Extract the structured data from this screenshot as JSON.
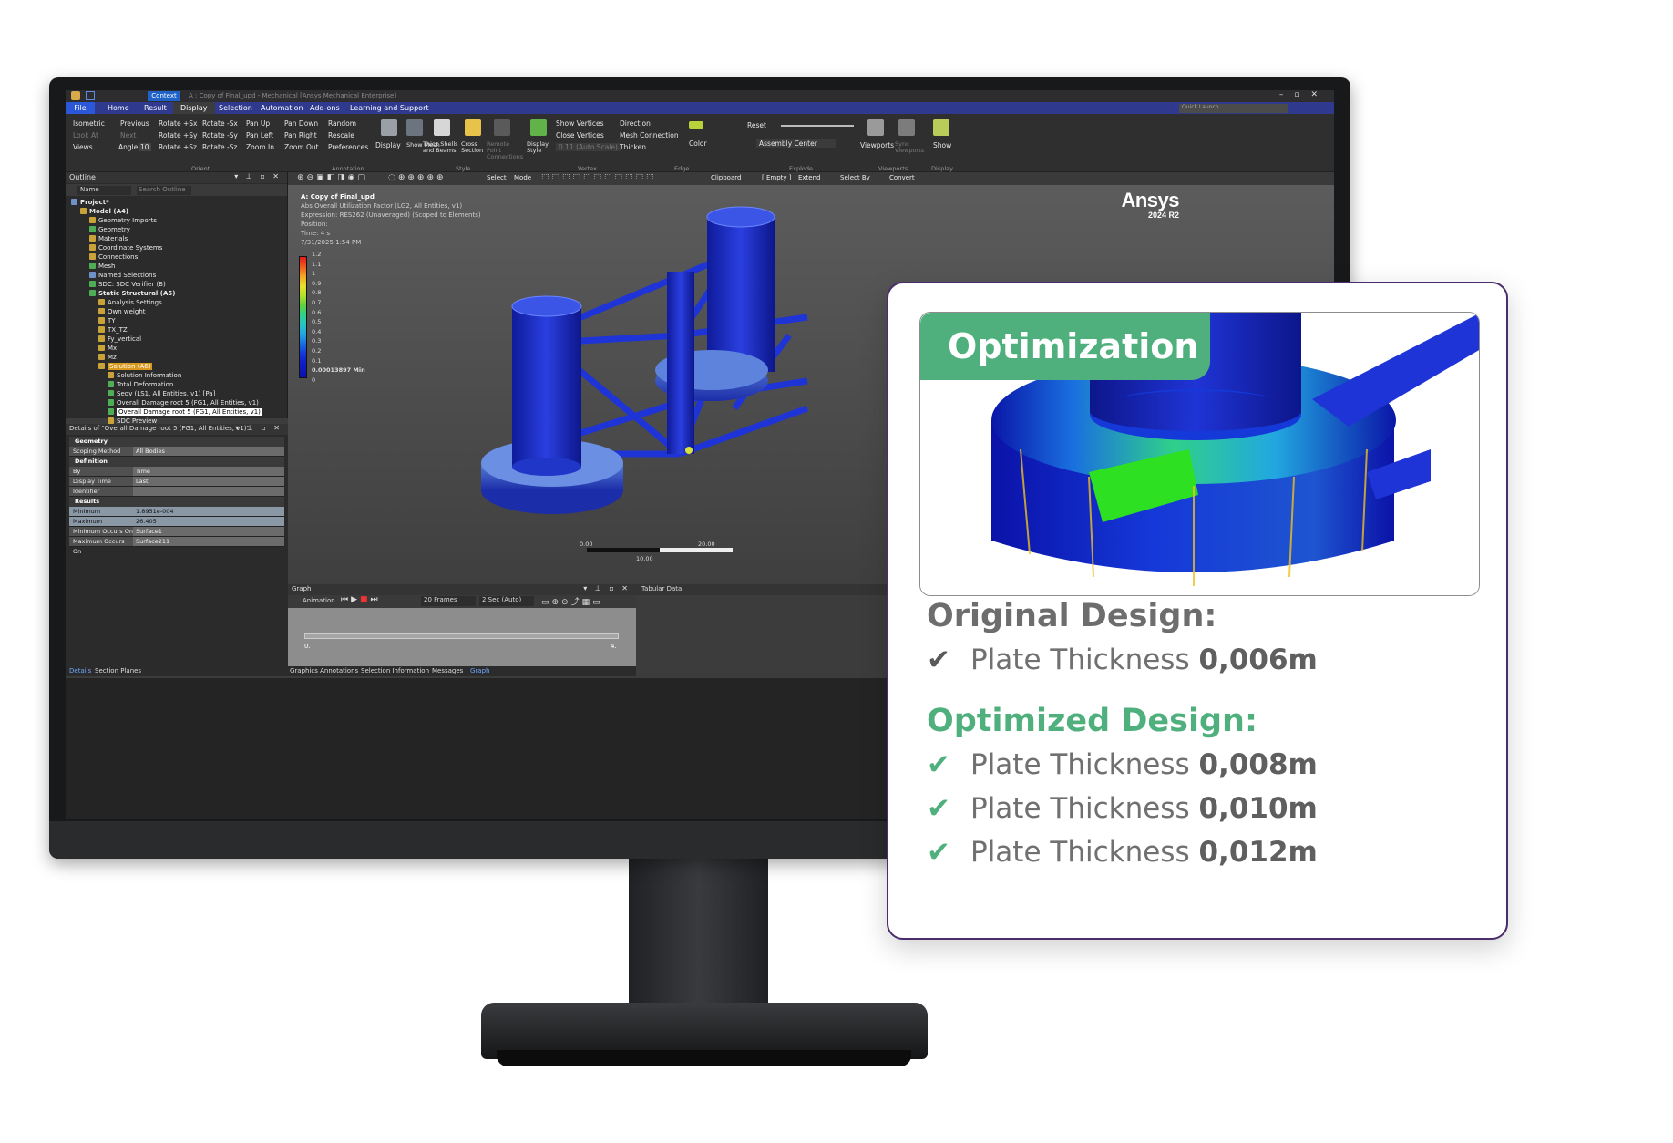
{
  "app": {
    "context_tab": "Context",
    "title": "A : Copy of Final_upd - Mechanical [Ansys Mechanical Enterprise]",
    "quick_launch": "Quick Launch",
    "tabs": [
      "File",
      "Home",
      "Result",
      "Display",
      "Selection",
      "Automation",
      "Add-ons",
      "Learning and Support"
    ]
  },
  "ribbon": {
    "orient": [
      "Isometric",
      "Previous",
      "Rotate +Sx",
      "Rotate -Sx",
      "Pan Up",
      "Pan Down",
      "Look At",
      "Next",
      "Rotate +Sy",
      "Rotate -Sy",
      "Pan Left",
      "Pan Right",
      "Views",
      "Angle",
      "10",
      "Rotate +Sz",
      "Rotate -Sz",
      "Zoom In",
      "Zoom Out"
    ],
    "annotation": [
      "Random",
      "Rescale",
      "Preferences"
    ],
    "style": [
      "Display",
      "Show Mesh",
      "Thick Shells and Beams",
      "Cross Section",
      "Remote Point Connections",
      "Display Style"
    ],
    "vertex": [
      "Show Vertices",
      "Close Vertices",
      "0.11 (Auto Scale)"
    ],
    "edge": [
      "Direction",
      "Mesh Connection",
      "Thicken",
      "Color"
    ],
    "explode": [
      "Reset",
      "Assembly Center"
    ],
    "viewports": [
      "Viewports",
      "Sync Viewports"
    ],
    "display": [
      "Show"
    ],
    "groups": [
      "Orient",
      "Annotation",
      "Style",
      "Vertex",
      "Edge",
      "Explode",
      "Viewports",
      "Display"
    ]
  },
  "outline": {
    "title": "Outline",
    "name_label": "Name",
    "search_placeholder": "Search Outline",
    "tree": [
      {
        "label": "Project*",
        "level": 0,
        "icon": "b",
        "style": "bold"
      },
      {
        "label": "Model (A4)",
        "level": 1,
        "icon": "y",
        "style": "bold"
      },
      {
        "label": "Geometry Imports",
        "level": 2,
        "icon": "y"
      },
      {
        "label": "Geometry",
        "level": 2,
        "icon": "g"
      },
      {
        "label": "Materials",
        "level": 2,
        "icon": "y"
      },
      {
        "label": "Coordinate Systems",
        "level": 2,
        "icon": "y"
      },
      {
        "label": "Connections",
        "level": 2,
        "icon": "y"
      },
      {
        "label": "Mesh",
        "level": 2,
        "icon": "g"
      },
      {
        "label": "Named Selections",
        "level": 2,
        "icon": "b"
      },
      {
        "label": "SDC: SDC Verifier (B)",
        "level": 2,
        "icon": "g"
      },
      {
        "label": "Static Structural (A5)",
        "level": 2,
        "icon": "g",
        "style": "bold"
      },
      {
        "label": "Analysis Settings",
        "level": 3,
        "icon": "y"
      },
      {
        "label": "Own weight",
        "level": 3,
        "icon": "y"
      },
      {
        "label": "TY",
        "level": 3,
        "icon": "y"
      },
      {
        "label": "TX_TZ",
        "level": 3,
        "icon": "y"
      },
      {
        "label": "Fy_vertical",
        "level": 3,
        "icon": "y"
      },
      {
        "label": "Mx",
        "level": 3,
        "icon": "y"
      },
      {
        "label": "Mz",
        "level": 3,
        "icon": "y"
      },
      {
        "label": "Solution (A6)",
        "level": 3,
        "icon": "y",
        "style": "sel"
      },
      {
        "label": "Solution Information",
        "level": 4,
        "icon": "y"
      },
      {
        "label": "Total Deformation",
        "level": 4,
        "icon": "g"
      },
      {
        "label": "Seqv (LS1, All Entities, v1) [Pa]",
        "level": 4,
        "icon": "g"
      },
      {
        "label": "Overall Damage root 5 (FG1, All Entities, v1)",
        "level": 4,
        "icon": "g"
      },
      {
        "label": "Overall Damage root 5 (FG1, All Entities, v1)",
        "level": 4,
        "icon": "g",
        "style": "hl"
      },
      {
        "label": "SDC Preview",
        "level": 4,
        "icon": "y"
      }
    ]
  },
  "details": {
    "title": "Details of \"Overall Damage root 5 (FG1, All Entities, v1)\"",
    "sections": [
      {
        "name": "Geometry",
        "rows": [
          [
            "Scoping Method",
            "All Bodies"
          ]
        ]
      },
      {
        "name": "Definition",
        "rows": [
          [
            "By",
            "Time"
          ],
          [
            "Display Time",
            "Last"
          ],
          [
            "Identifier",
            ""
          ]
        ]
      },
      {
        "name": "Results",
        "rows": [
          [
            "Minimum",
            "1.8951e-004"
          ],
          [
            "Maximum",
            "26.405"
          ],
          [
            "Minimum Occurs On",
            "Surface1"
          ],
          [
            "Maximum Occurs On",
            "Surface211"
          ]
        ]
      }
    ],
    "tabs": [
      "Details",
      "Section Planes"
    ]
  },
  "toolbar": {
    "select": "Select",
    "mode": "Mode",
    "clipboard": "Clipboard",
    "empty": "[ Empty ]",
    "extend": "Extend",
    "select_by": "Select By",
    "convert": "Convert"
  },
  "graphics": {
    "title": "A: Copy of Final_upd",
    "subtitle": "Abs Overall Utilization Factor (LG2, All Entities, v1)",
    "expression": "Expression: RES262 (Unaveraged) (Scoped to Elements)",
    "position": "Position:",
    "time": "Time: 4 s",
    "date": "7/31/2025 1:54 PM",
    "legend": [
      "1.2",
      "1.1",
      "1",
      "0.9",
      "0.8",
      "0.7",
      "0.6",
      "0.5",
      "0.4",
      "0.3",
      "0.2",
      "0.1",
      "0.00013897 Min",
      "0"
    ],
    "brand": "Ansys",
    "version": "2024 R2",
    "scale": [
      "0.00",
      "20.00",
      "10.00"
    ]
  },
  "graph": {
    "title": "Graph",
    "animation": "Animation",
    "frames": "20 Frames",
    "duration": "2 Sec (Auto)",
    "t0": "0.",
    "t1": "4.",
    "tabular": "Tabular Data",
    "tabs": [
      "Graphics Annotations",
      "Selection Information",
      "Messages",
      "Graph"
    ]
  },
  "callout": {
    "badge": "Optimization",
    "original_heading": "Original Design:",
    "optimized_heading": "Optimized Design:",
    "label": "Plate Thickness",
    "original": [
      "0,006m"
    ],
    "optimized": [
      "0,008m",
      "0,010m",
      "0,012m"
    ],
    "accent": "#4fb07e",
    "border": "#4a2d6a"
  }
}
